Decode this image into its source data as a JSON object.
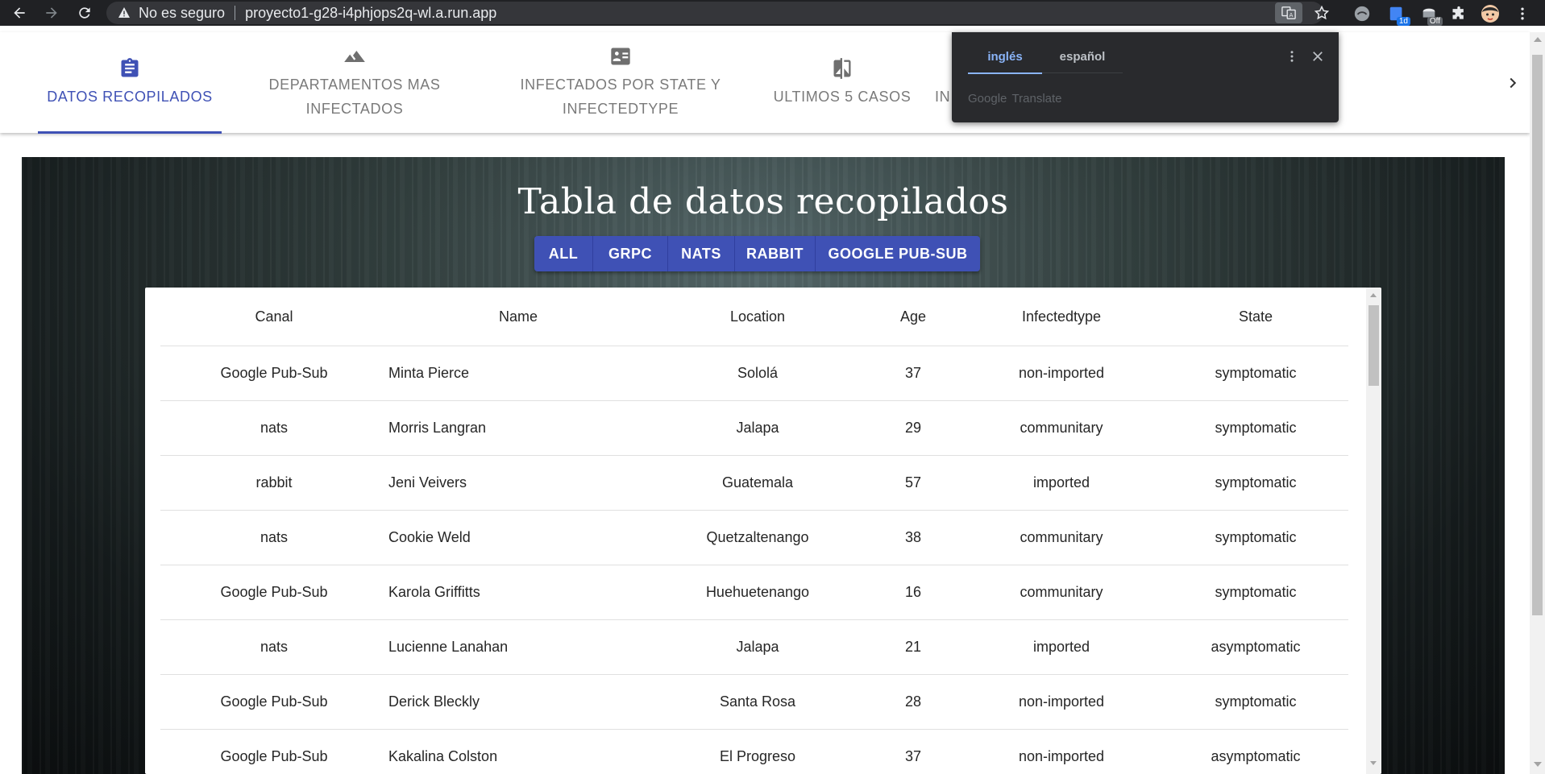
{
  "browser": {
    "security_label": "No es seguro",
    "url": "proyecto1-g28-i4phjops2q-wl.a.run.app",
    "extensions": [
      {
        "name": "ext-gray-circle",
        "badge": ""
      },
      {
        "name": "ext-blue-calendar",
        "badge": "1d"
      },
      {
        "name": "ext-off",
        "badge": "Off"
      },
      {
        "name": "puzzle",
        "badge": ""
      },
      {
        "name": "avatar",
        "badge": ""
      }
    ]
  },
  "tabs": [
    {
      "label": "DATOS RECOPILADOS",
      "icon": "clipboard-icon",
      "active": true
    },
    {
      "label": "DEPARTAMENTOS MAS INFECTADOS",
      "icon": "landscape-icon",
      "active": false
    },
    {
      "label": "INFECTADOS POR STATE Y INFECTEDTYPE",
      "icon": "contact-card-icon",
      "active": false
    },
    {
      "label": "ULTIMOS 5 CASOS",
      "icon": "compare-icon",
      "active": false
    },
    {
      "label": "IN",
      "icon": "",
      "active": false
    }
  ],
  "translate_popup": {
    "lang_from": "inglés",
    "lang_to": "español",
    "brand": "Google",
    "product": "Translate"
  },
  "page": {
    "title": "Tabla de datos recopilados",
    "filters": [
      "ALL",
      "GRPC",
      "NATS",
      "RABBIT",
      "GOOGLE PUB-SUB"
    ]
  },
  "table": {
    "columns": [
      "Canal",
      "Name",
      "Location",
      "Age",
      "Infectedtype",
      "State"
    ],
    "rows": [
      [
        "Google Pub-Sub",
        "Minta Pierce",
        "Sololá",
        "37",
        "non-imported",
        "symptomatic"
      ],
      [
        "nats",
        "Morris Langran",
        "Jalapa",
        "29",
        "communitary",
        "symptomatic"
      ],
      [
        "rabbit",
        "Jeni Veivers",
        "Guatemala",
        "57",
        "imported",
        "symptomatic"
      ],
      [
        "nats",
        "Cookie Weld",
        "Quetzaltenango",
        "38",
        "communitary",
        "symptomatic"
      ],
      [
        "Google Pub-Sub",
        "Karola Griffitts",
        "Huehuetenango",
        "16",
        "communitary",
        "symptomatic"
      ],
      [
        "nats",
        "Lucienne Lanahan",
        "Jalapa",
        "21",
        "imported",
        "asymptomatic"
      ],
      [
        "Google Pub-Sub",
        "Derick Bleckly",
        "Santa Rosa",
        "28",
        "non-imported",
        "symptomatic"
      ],
      [
        "Google Pub-Sub",
        "Kakalina Colston",
        "El Progreso",
        "37",
        "non-imported",
        "asymptomatic"
      ]
    ]
  },
  "colors": {
    "primary": "#3f51b5",
    "chrome": "#202124",
    "tab_inactive": "#7a7a7a"
  }
}
